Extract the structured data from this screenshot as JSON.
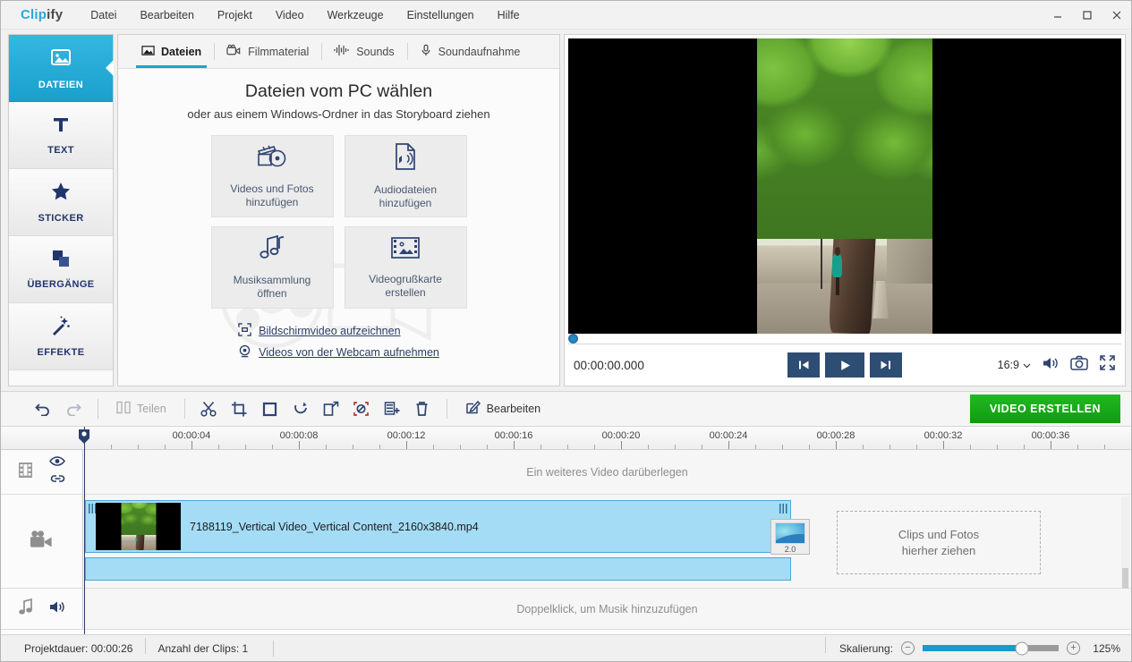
{
  "window": {
    "logo_primary": "Clip",
    "logo_secondary": "ify",
    "menu": [
      "Datei",
      "Bearbeiten",
      "Projekt",
      "Video",
      "Werkzeuge",
      "Einstellungen",
      "Hilfe"
    ],
    "controls": {
      "minimize": "minimize-icon",
      "maximize": "maximize-icon",
      "close": "close-icon"
    }
  },
  "sidebar": {
    "items": [
      {
        "label": "DATEIEN",
        "icon": "image-icon",
        "active": true
      },
      {
        "label": "TEXT",
        "icon": "text-t-icon",
        "active": false
      },
      {
        "label": "STICKER",
        "icon": "star-icon",
        "active": false
      },
      {
        "label": "ÜBERGÄNGE",
        "icon": "layers-icon",
        "active": false
      },
      {
        "label": "EFFEKTE",
        "icon": "magic-wand-icon",
        "active": false
      }
    ]
  },
  "tabs": [
    {
      "label": "Dateien",
      "icon": "picture-icon",
      "active": true
    },
    {
      "label": "Filmmaterial",
      "icon": "video-camera-icon",
      "active": false
    },
    {
      "label": "Sounds",
      "icon": "waveform-icon",
      "active": false
    },
    {
      "label": "Soundaufnahme",
      "icon": "microphone-icon",
      "active": false
    }
  ],
  "panel": {
    "heading": "Dateien vom PC wählen",
    "subheading": "oder aus einem Windows-Ordner in das Storyboard ziehen",
    "cards": [
      {
        "line1": "Videos und Fotos",
        "line2": "hinzufügen",
        "icon": "film-clapper-icon"
      },
      {
        "line1": "Audiodateien",
        "line2": "hinzufügen",
        "icon": "audio-file-icon"
      },
      {
        "line1": "Musiksammlung",
        "line2": "öffnen",
        "icon": "music-notes-icon"
      },
      {
        "line1": "Videogrußkarte",
        "line2": "erstellen",
        "icon": "filmstrip-photo-icon"
      }
    ],
    "links": [
      {
        "label": "Bildschirmvideo aufzeichnen",
        "icon": "screen-capture-icon"
      },
      {
        "label": "Videos von der Webcam aufnehmen",
        "icon": "webcam-icon"
      }
    ]
  },
  "preview": {
    "timecode": "00:00:00.000",
    "aspect_ratio": "16:9",
    "buttons": {
      "previous": "skip-previous-icon",
      "play": "play-icon",
      "next": "skip-next-icon",
      "volume": "volume-icon",
      "snapshot": "camera-icon",
      "fullscreen": "fullscreen-icon"
    }
  },
  "toolbar": {
    "undo": "undo-icon",
    "redo": "redo-icon",
    "split_label": "Teilen",
    "tools": [
      {
        "name": "cut-icon"
      },
      {
        "name": "crop-icon"
      },
      {
        "name": "stabilize-icon"
      },
      {
        "name": "rotate-icon"
      },
      {
        "name": "pan-zoom-icon"
      },
      {
        "name": "chroma-key-icon"
      },
      {
        "name": "speed-icon"
      },
      {
        "name": "delete-icon"
      }
    ],
    "edit_label": "Bearbeiten",
    "create_label": "VIDEO ERSTELLEN",
    "create_color": "#13a313"
  },
  "timeline": {
    "ruler_labels": [
      "00:00:04",
      "00:00:08",
      "00:00:12",
      "00:00:16",
      "00:00:20",
      "00:00:24",
      "00:00:28",
      "00:00:32",
      "00:00:36"
    ],
    "overlay_hint": "Ein weiteres Video darüberlegen",
    "audio_hint": "Doppelklick, um Musik hinzuzufügen",
    "dropzone_line1": "Clips und Fotos",
    "dropzone_line2": "hierher ziehen",
    "clip": {
      "name": "7188119_Vertical Video_Vertical Content_2160x3840.mp4",
      "selected_color": "#a4dcf5"
    },
    "transition": {
      "label": "2.0"
    },
    "track_icons": {
      "overlay": "filmstrip-icon",
      "overlay_eye": "eye-icon",
      "overlay_link": "link-icon",
      "video": "video-camera-icon",
      "audio_note": "music-note-icon",
      "audio_speaker": "speaker-icon"
    }
  },
  "status": {
    "duration_label": "Projektdauer:",
    "duration_value": "00:00:26",
    "clips_label": "Anzahl der Clips:",
    "clips_value": "1",
    "scale_label": "Skalierung:",
    "scale_value": "125%",
    "scale_percent": 73
  }
}
